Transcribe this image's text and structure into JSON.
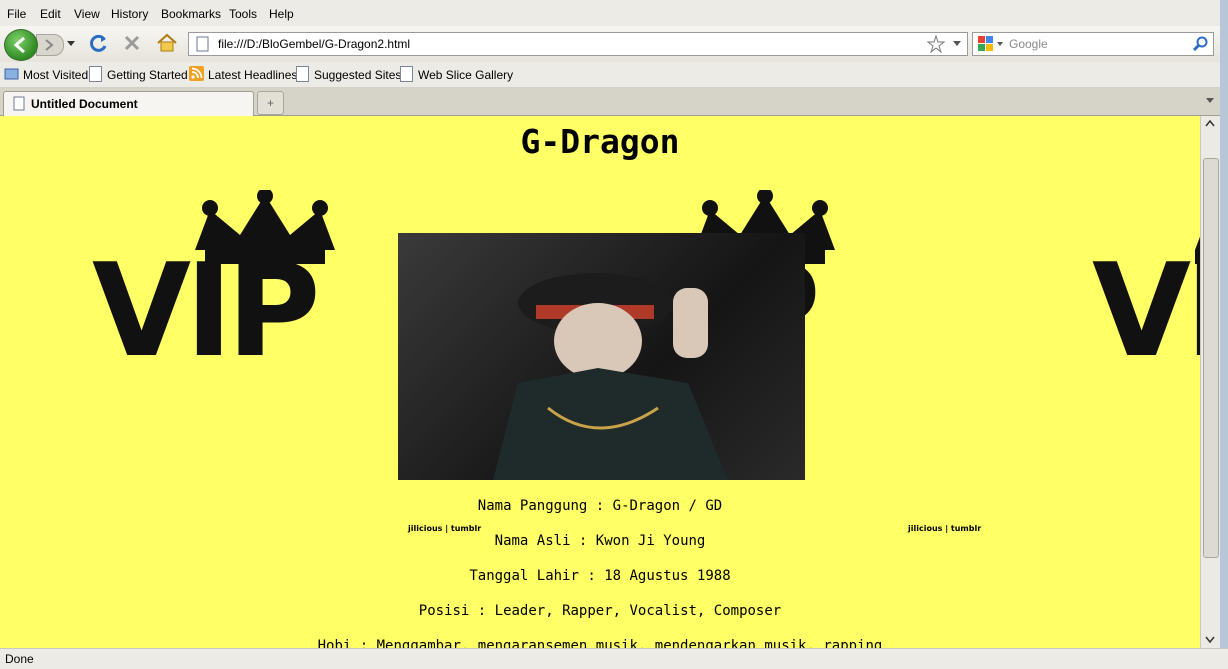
{
  "menu": [
    "File",
    "Edit",
    "View",
    "History",
    "Bookmarks",
    "Tools",
    "Help"
  ],
  "address": {
    "url": "file:///D:/BloGembel/G-Dragon2.html"
  },
  "search": {
    "placeholder": "Google"
  },
  "bookmarks": [
    "Most Visited",
    "Getting Started",
    "Latest Headlines",
    "Suggested Sites",
    "Web Slice Gallery"
  ],
  "tab": {
    "title": "Untitled Document"
  },
  "page": {
    "heading": "G-Dragon",
    "vip_text": "VIP",
    "watermark": "jilicious | tumblr",
    "info": [
      "Nama Panggung : G-Dragon / GD",
      "Nama Asli : Kwon Ji Young",
      "Tanggal Lahir : 18 Agustus 1988",
      "Posisi : Leader, Rapper, Vocalist, Composer",
      "Hobi : Menggambar, mengaransemen musik, mendengarkan musik, rapping"
    ]
  },
  "status": {
    "text": "Done"
  },
  "colors": {
    "page_bg": "#ffff66",
    "back_button": "#3fa02e"
  }
}
